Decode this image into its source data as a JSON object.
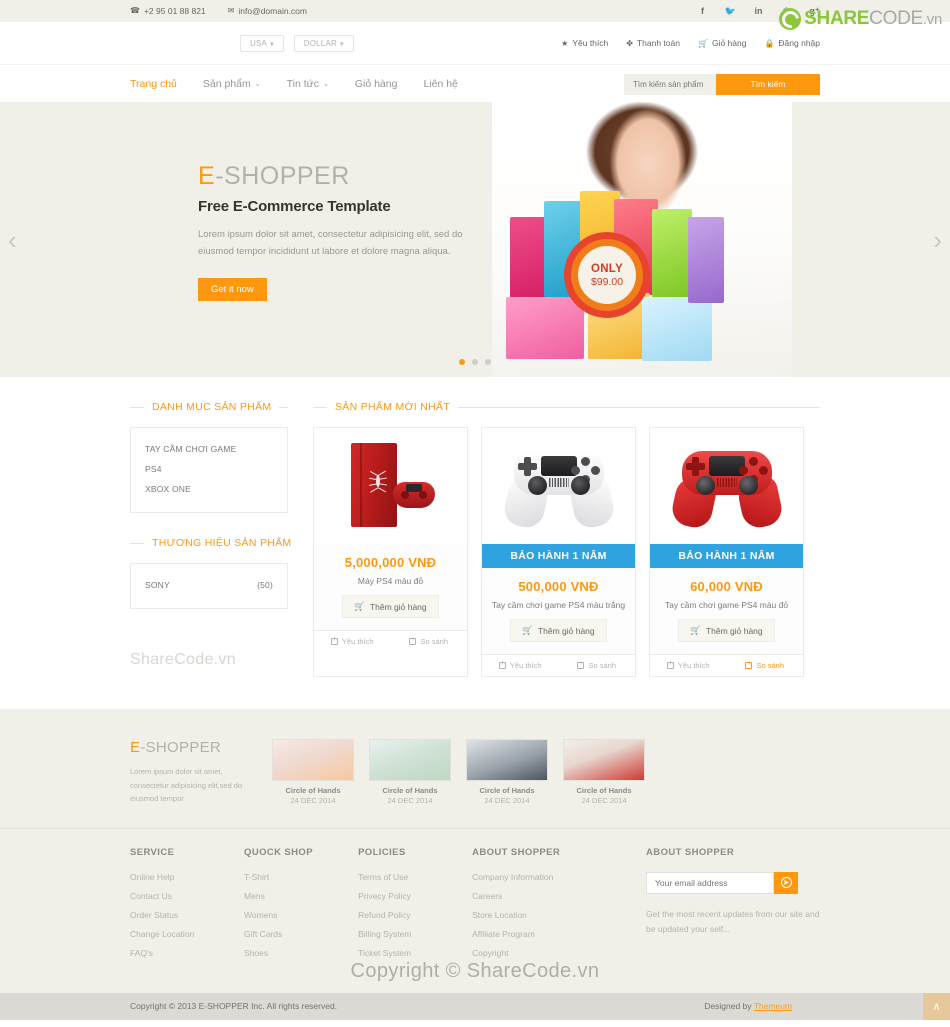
{
  "topbar": {
    "phone": "+2 95 01 88 821",
    "email": "info@domain.com",
    "phone_icon": "phone-icon",
    "email_icon": "envelope-icon",
    "social": [
      {
        "name": "facebook-icon",
        "glyph": "f"
      },
      {
        "name": "twitter-icon",
        "glyph": "ᵛ"
      },
      {
        "name": "linkedin-icon",
        "glyph": "in"
      },
      {
        "name": "dribbble-icon",
        "glyph": "⊛"
      },
      {
        "name": "google-plus-icon",
        "glyph": "g⁺"
      }
    ]
  },
  "sharecode": {
    "share": "SHARE",
    "code": "CODE",
    "vn": ".vn"
  },
  "header": {
    "country_select": "USA",
    "currency_select": "DOLLAR",
    "caret": "▾",
    "links": [
      {
        "label": "Yêu thích",
        "icon": "star-icon",
        "glyph": "★"
      },
      {
        "label": "Thanh toán",
        "icon": "checkout-icon",
        "glyph": "✤"
      },
      {
        "label": "Giỏ hàng",
        "icon": "cart-icon",
        "glyph": "🛒"
      },
      {
        "label": "Đăng nhập",
        "icon": "lock-icon",
        "glyph": "🔒"
      }
    ]
  },
  "nav": {
    "items": [
      {
        "label": "Trang chủ",
        "active": true,
        "caret": ""
      },
      {
        "label": "Sản phẩm",
        "active": false,
        "caret": "˅"
      },
      {
        "label": "Tin tức",
        "active": false,
        "caret": "˅"
      },
      {
        "label": "Giỏ hàng",
        "active": false,
        "caret": ""
      },
      {
        "label": "Liên hệ",
        "active": false,
        "caret": ""
      }
    ],
    "search_placeholder": "Tìm kiếm sản phẩm",
    "search_button": "Tìm kiếm"
  },
  "slider": {
    "brand_first": "E",
    "brand_rest": "-SHOPPER",
    "heading": "Free E-Commerce Template",
    "paragraph": "Lorem ipsum dolor sit amet, consectetur adipisicing elit, sed do eiusmod tempor incididunt ut labore et dolore magna aliqua.",
    "cta": "Get it now",
    "badge_label": "ONLY",
    "badge_price": "$99.00",
    "prev_arrow": "‹",
    "next_arrow": "›",
    "dots": 3,
    "active_dot": 0
  },
  "sidebar": {
    "categories_title": "DANH MỤC SẢN PHẨM",
    "categories": [
      "TAY CẦM CHƠI GAME",
      "PS4",
      "XBOX ONE"
    ],
    "brands_title": "THƯƠNG HIỆU SẢN PHẨM",
    "brands": [
      {
        "name": "SONY",
        "count": "(50)"
      }
    ],
    "watermark": "ShareCode.vn"
  },
  "products": {
    "title": "SẢN PHẨM MỚI NHẤT",
    "items": [
      {
        "warranty": "",
        "price": "5,000,000 VNĐ",
        "name": "Máy PS4 màu đỏ",
        "add_label": "Thêm giỏ hàng",
        "wish_label": "Yêu thích",
        "compare_label": "So sánh",
        "compare_highlight": false,
        "art": "console-red"
      },
      {
        "warranty": "BẢO HÀNH 1 NĂM",
        "price": "500,000 VNĐ",
        "name": "Tay cầm chơi game PS4 màu trắng",
        "add_label": "Thêm giỏ hàng",
        "wish_label": "Yêu thích",
        "compare_label": "So sánh",
        "compare_highlight": false,
        "art": "pad-white"
      },
      {
        "warranty": "BẢO HÀNH 1 NĂM",
        "price": "60,000 VNĐ",
        "name": "Tay cầm chơi game PS4 màu đỏ",
        "add_label": "Thêm giỏ hàng",
        "wish_label": "Yêu thích",
        "compare_label": "So sánh",
        "compare_highlight": true,
        "art": "pad-red"
      }
    ]
  },
  "footer": {
    "brand_first": "E",
    "brand_rest": "-SHOPPER",
    "about": "Lorem ipsum dolor sit amet, consectetur adipisicing elit,sed do eiusmod tempor",
    "posts": [
      {
        "title": "Circle of Hands",
        "date": "24 DEC 2014"
      },
      {
        "title": "Circle of Hands",
        "date": "24 DEC 2014"
      },
      {
        "title": "Circle of Hands",
        "date": "24 DEC 2014"
      },
      {
        "title": "Circle of Hands",
        "date": "24 DEC 2014"
      }
    ],
    "columns": [
      {
        "heading": "SERVICE",
        "links": [
          "Online Help",
          "Contact Us",
          "Order Status",
          "Change Location",
          "FAQ's"
        ]
      },
      {
        "heading": "QUOCK SHOP",
        "links": [
          "T-Shirt",
          "Mens",
          "Womens",
          "Gift Cards",
          "Shoes"
        ]
      },
      {
        "heading": "POLICIES",
        "links": [
          "Terms of Use",
          "Privecy Policy",
          "Refund Policy",
          "Billing System",
          "Ticket System"
        ]
      },
      {
        "heading": "ABOUT SHOPPER",
        "links": [
          "Company Information",
          "Careers",
          "Store Location",
          "Affiliate Program",
          "Copyright"
        ]
      }
    ],
    "newsletter": {
      "heading": "ABOUT SHOPPER",
      "placeholder": "Your email address",
      "submit_glyph": "➤",
      "note": "Get the most recent updates from our site and be updated your self..."
    }
  },
  "copybar": {
    "left": "Copyright © 2013 E-SHOPPER Inc. All rights reserved.",
    "right_prefix": "Designed by ",
    "right_link": "Themeum",
    "totop_glyph": "∧"
  },
  "watermark": "Copyright © ShareCode.vn",
  "colors": {
    "accent": "#fe980f",
    "warranty": "#2fa3e0",
    "brand_green": "#8cc63f",
    "badge": "#e8432d"
  }
}
